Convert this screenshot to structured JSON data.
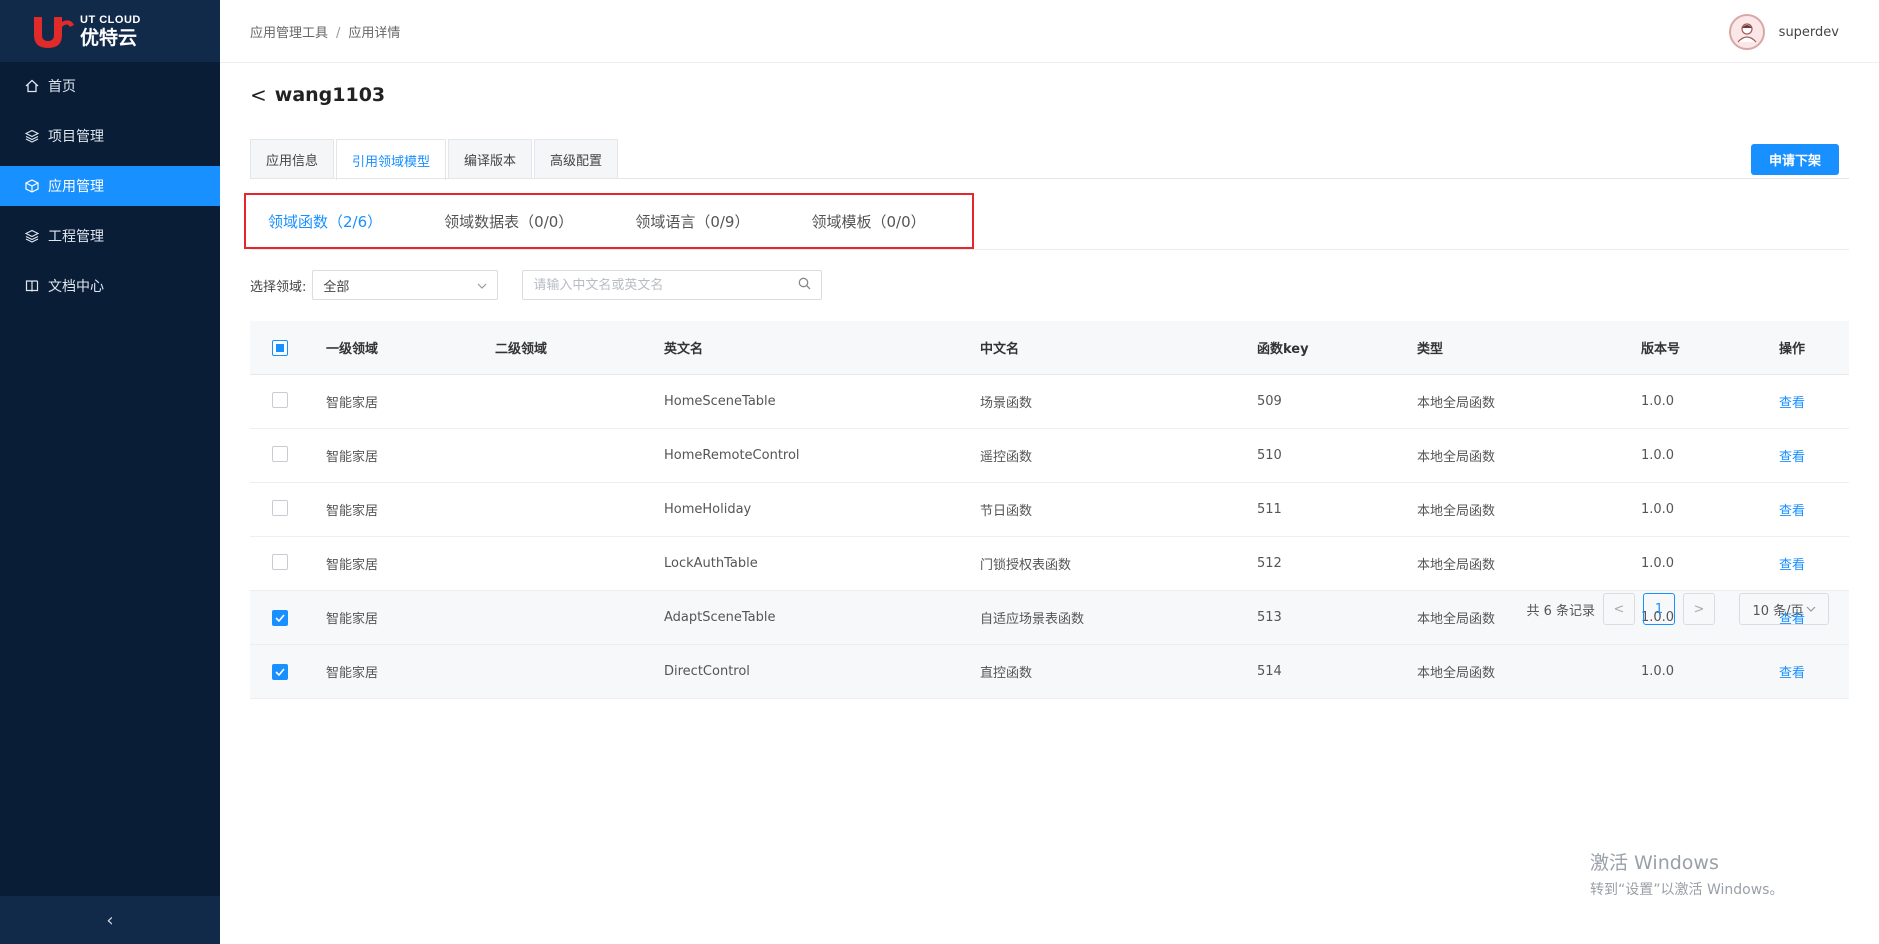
{
  "logo": {
    "en": "UT CLOUD",
    "cn": "优特云"
  },
  "sidebar": {
    "items": [
      {
        "label": "首页",
        "icon": "home-icon"
      },
      {
        "label": "项目管理",
        "icon": "layers-icon"
      },
      {
        "label": "应用管理",
        "icon": "cube-icon",
        "active": true
      },
      {
        "label": "工程管理",
        "icon": "layers-icon"
      },
      {
        "label": "文档中心",
        "icon": "book-icon"
      }
    ],
    "collapse": "‹"
  },
  "header": {
    "breadcrumb": [
      "应用管理工具",
      "应用详情"
    ],
    "separator": "/",
    "username": "superdev"
  },
  "page": {
    "title": "wang1103",
    "back": "<",
    "tabs": [
      "应用信息",
      "引用领域模型",
      "编译版本",
      "高级配置"
    ],
    "active_tab": 1,
    "action_button": "申请下架",
    "subtabs": [
      "领域函数（2/6）",
      "领域数据表（0/0）",
      "领域语言（0/9）",
      "领域模板（0/0）"
    ],
    "active_subtab": 0
  },
  "filter": {
    "label": "选择领域:",
    "select_value": "全部",
    "search_placeholder": "请输入中文名或英文名"
  },
  "table": {
    "columns": [
      "一级领域",
      "二级领域",
      "英文名",
      "中文名",
      "函数key",
      "类型",
      "版本号",
      "操作"
    ],
    "rows": [
      {
        "checked": false,
        "l1": "智能家居",
        "l2": "",
        "en": "HomeSceneTable",
        "cn": "场景函数",
        "key": "509",
        "type": "本地全局函数",
        "ver": "1.0.0",
        "op": "查看"
      },
      {
        "checked": false,
        "l1": "智能家居",
        "l2": "",
        "en": "HomeRemoteControl",
        "cn": "遥控函数",
        "key": "510",
        "type": "本地全局函数",
        "ver": "1.0.0",
        "op": "查看"
      },
      {
        "checked": false,
        "l1": "智能家居",
        "l2": "",
        "en": "HomeHoliday",
        "cn": "节日函数",
        "key": "511",
        "type": "本地全局函数",
        "ver": "1.0.0",
        "op": "查看"
      },
      {
        "checked": false,
        "l1": "智能家居",
        "l2": "",
        "en": "LockAuthTable",
        "cn": "门锁授权表函数",
        "key": "512",
        "type": "本地全局函数",
        "ver": "1.0.0",
        "op": "查看"
      },
      {
        "checked": true,
        "l1": "智能家居",
        "l2": "",
        "en": "AdaptSceneTable",
        "cn": "自适应场景表函数",
        "key": "513",
        "type": "本地全局函数",
        "ver": "1.0.0",
        "op": "查看"
      },
      {
        "checked": true,
        "l1": "智能家居",
        "l2": "",
        "en": "DirectControl",
        "cn": "直控函数",
        "key": "514",
        "type": "本地全局函数",
        "ver": "1.0.0",
        "op": "查看"
      }
    ]
  },
  "pagination": {
    "total": "共 6 条记录",
    "prev": "<",
    "current": "1",
    "next": ">",
    "page_size": "10 条/页"
  },
  "watermark": {
    "line1": "激活 Windows",
    "line2": "转到“设置”以激活 Windows。"
  },
  "colors": {
    "accent": "#1890ff",
    "sidebar": "#0a1d36",
    "highlight_box": "#e5262d"
  }
}
